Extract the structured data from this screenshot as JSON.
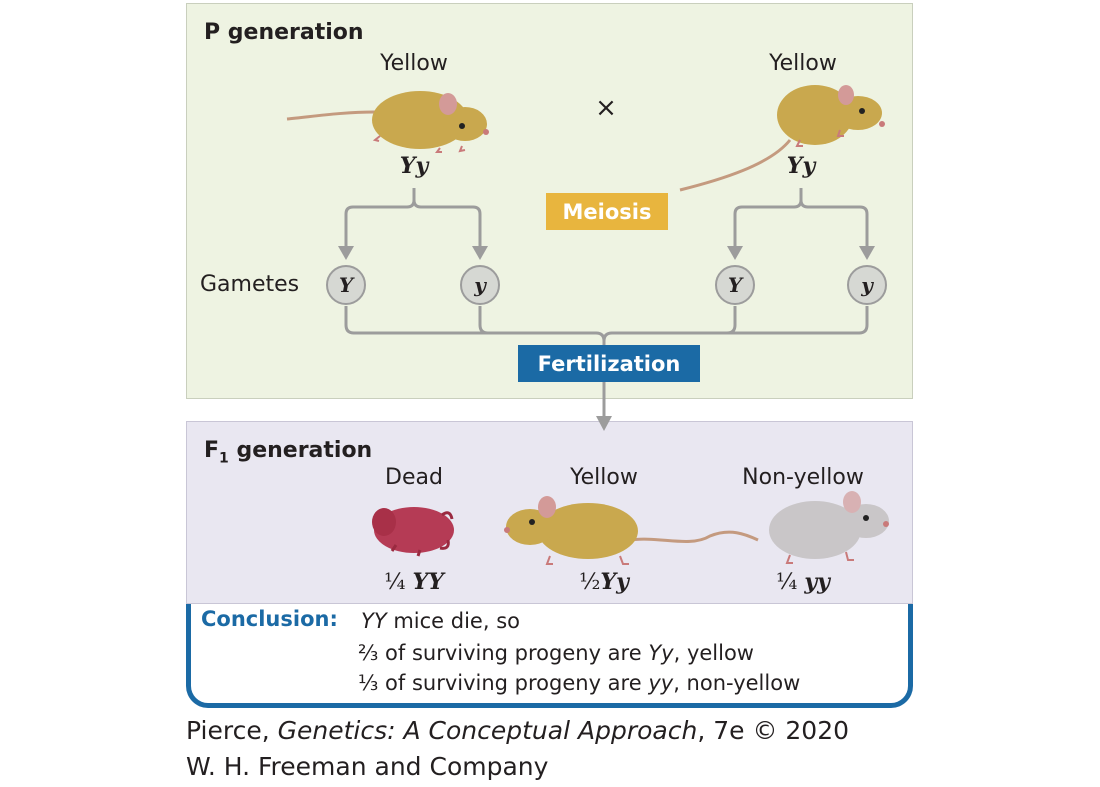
{
  "p_generation": {
    "title": "P generation",
    "left_parent": {
      "phenotype": "Yellow",
      "genotype": "Yy"
    },
    "right_parent": {
      "phenotype": "Yellow",
      "genotype": "Yy"
    },
    "cross_symbol": "×",
    "meiosis_label": "Meiosis",
    "gametes_label": "Gametes",
    "gametes": [
      "Y",
      "y",
      "Y",
      "y"
    ],
    "fertilization_label": "Fertilization"
  },
  "f1_generation": {
    "title": "F",
    "title_sub": "1",
    "title_rest": " generation",
    "progeny": [
      {
        "phenotype": "Dead",
        "fraction": "¼",
        "genotype": "YY"
      },
      {
        "phenotype": "Yellow",
        "fraction": "½",
        "genotype": "Yy"
      },
      {
        "phenotype": "Non-yellow",
        "fraction": "¼",
        "genotype": "yy"
      }
    ]
  },
  "conclusion": {
    "heading": "Conclusion:",
    "line1_geno": "YY",
    "line1_rest": " mice die, so",
    "line2_pre": "⅔ of surviving progeny are ",
    "line2_geno": "Yy",
    "line2_post": ", yellow",
    "line3_pre": "⅓ of surviving progeny are ",
    "line3_geno": "yy",
    "line3_post": ", non-yellow"
  },
  "credit": {
    "author": "Pierce, ",
    "book": "Genetics: A Conceptual Approach",
    "edition": ", 7e © 2020",
    "publisher": "W. H. Freeman and Company"
  },
  "colors": {
    "meiosis": "#e8b53e",
    "fertilization": "#1b6aa5",
    "p_background": "#eef3e2",
    "f1_background": "#e9e7f1",
    "yellow_mouse": "#c9a84e",
    "gray_mouse": "#c9c6c8",
    "dead_mouse": "#b53b55"
  }
}
